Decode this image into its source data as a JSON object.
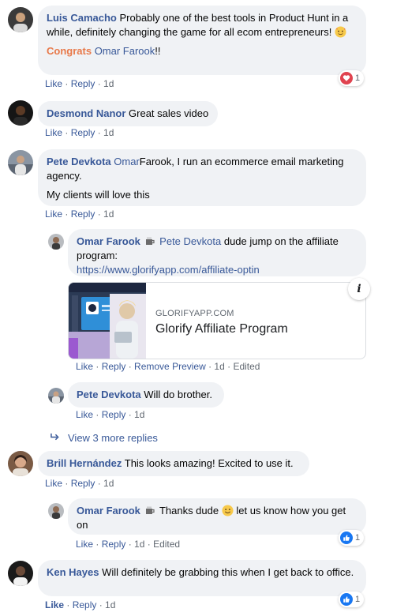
{
  "comments": {
    "luis": {
      "name": "Luis Camacho",
      "text": "Probably one of the best tools in Product Hunt in a while, definitely changing the game for all ecom entrepreneurs!",
      "congrats": "Congrats",
      "mention": "Omar Farook",
      "suffix": "!!",
      "like": "Like",
      "reply": "Reply",
      "time": "1d",
      "reaction_count": "1",
      "reaction_type": "love-icon"
    },
    "desmond": {
      "name": "Desmond Nanor",
      "text": "Great sales video",
      "like": "Like",
      "reply": "Reply",
      "time": "1d"
    },
    "pete": {
      "name": "Pete Devkota",
      "mention": "Omar",
      "text": "Farook, I run an ecommerce email marketing agency.",
      "text2": "My clients will love this",
      "like": "Like",
      "reply": "Reply",
      "time": "1d"
    },
    "omar_reply": {
      "name": "Omar Farook",
      "mention": "Pete Devkota",
      "text": "dude jump on the affiliate program:",
      "link": "https://www.glorifyapp.com/affiliate-optin",
      "preview_domain": "GLORIFYAPP.COM",
      "preview_title": "Glorify Affiliate Program",
      "like": "Like",
      "reply": "Reply",
      "remove_preview": "Remove Preview",
      "time": "1d",
      "edited": "Edited"
    },
    "pete_reply": {
      "name": "Pete Devkota",
      "text": "Will do brother.",
      "like": "Like",
      "reply": "Reply",
      "time": "1d"
    },
    "view_more": "View 3 more replies",
    "brill": {
      "name": "Brill Hernández",
      "text": "This looks amazing! Excited to use it.",
      "like": "Like",
      "reply": "Reply",
      "time": "1d"
    },
    "omar_reply2": {
      "name": "Omar Farook",
      "text_before": "Thanks dude",
      "text_after": "let us know how you get on",
      "like": "Like",
      "reply": "Reply",
      "time": "1d",
      "edited": "Edited",
      "reaction_count": "1",
      "reaction_type": "like-icon"
    },
    "ken": {
      "name": "Ken Hayes",
      "text": "Will definitely be grabbing this when I get back to office.",
      "like": "Like",
      "reply": "Reply",
      "time": "1d",
      "reaction_count": "1",
      "reaction_type": "like-icon"
    }
  },
  "colors": {
    "name_link": "#385898",
    "bubble_bg": "#f0f2f5",
    "meta_gray": "#606770",
    "love": "#e0434f",
    "like": "#1877f2",
    "congrats": "#e8794a"
  }
}
